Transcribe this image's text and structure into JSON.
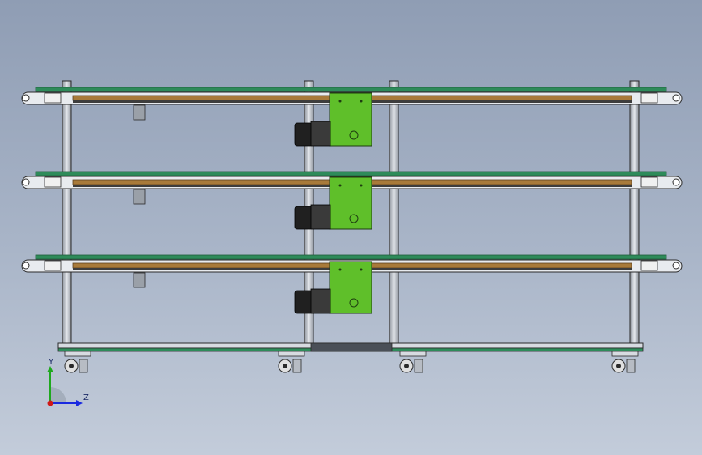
{
  "viewport": {
    "background_top": "#8f9db4",
    "background_bottom": "#c3ccda"
  },
  "model": {
    "conveyor_levels": 3,
    "motor_units": 3,
    "casters": 4,
    "colors": {
      "belt_green": "#2e8b5a",
      "guide_wood": "#a87a3a",
      "motor_plate": "#5fbf2a",
      "motor_body": "#202020",
      "frame": "#c9ced6",
      "outline": "#2a2a2a"
    }
  },
  "triad": {
    "y_label": "Y",
    "z_label": "Z",
    "y_color": "#1ea81e",
    "z_color": "#1a2ae0",
    "x_color": "#d01818"
  }
}
